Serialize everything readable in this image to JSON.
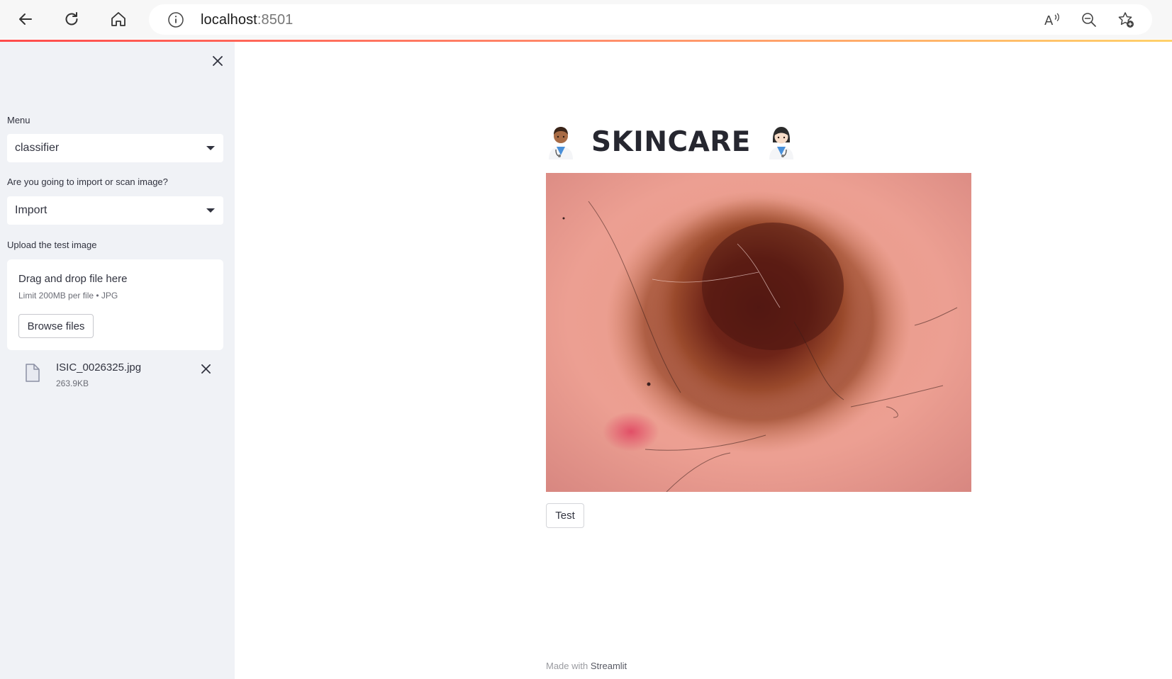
{
  "browser": {
    "url_host": "localhost",
    "url_port": ":8501",
    "icons": [
      "back-arrow-icon",
      "refresh-icon",
      "home-icon",
      "info-icon",
      "read-aloud-icon",
      "zoom-out-icon",
      "add-favorite-icon"
    ]
  },
  "sidebar": {
    "menu_label": "Menu",
    "menu_value": "classifier",
    "mode_label": "Are you going to import or scan image?",
    "mode_value": "Import",
    "upload_label": "Upload the test image",
    "dropzone_title": "Drag and drop file here",
    "dropzone_limit": "Limit 200MB per file • JPG",
    "browse_label": "Browse files",
    "file": {
      "name": "ISIC_0026325.jpg",
      "size": "263.9KB"
    }
  },
  "main": {
    "title": "SKINCARE",
    "test_label": "Test"
  },
  "footer": {
    "prefix": "Made with ",
    "brand": "Streamlit"
  },
  "colors": {
    "accent": "#ff4b4b",
    "sidebar_bg": "#f0f2f6",
    "text": "#31333f"
  }
}
